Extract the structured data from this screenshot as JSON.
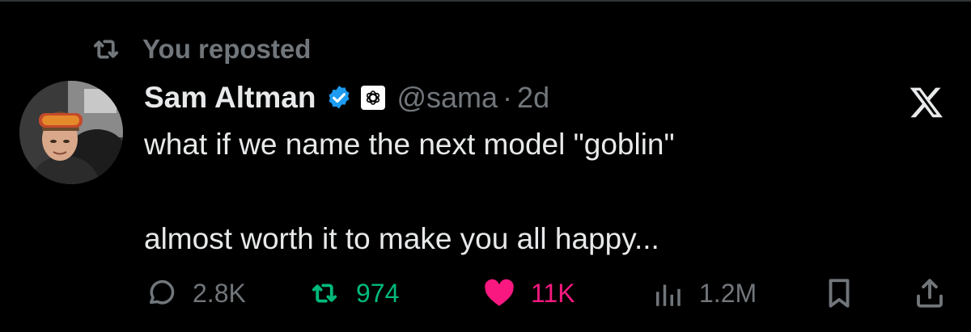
{
  "repost_banner": {
    "text": "You reposted",
    "icon": "repost-icon"
  },
  "author": {
    "name": "Sam Altman",
    "handle": "@sama",
    "separator": "·",
    "time": "2d",
    "verified_icon": "verified-badge-icon",
    "affiliation_icon": "openai-logo-icon"
  },
  "tweet": {
    "line1": "what if we name the next model \"goblin\"",
    "line2": "almost worth it to make you all happy..."
  },
  "actions": {
    "reply_count": "2.8K",
    "repost_count": "974",
    "like_count": "11K",
    "view_count": "1.2M"
  },
  "brand_icon": "x-logo-icon",
  "colors": {
    "background": "#000000",
    "text": "#e7e9ea",
    "muted": "#71767b",
    "repost_green": "#00ba7c",
    "like_pink": "#f91880",
    "verified_blue": "#1d9bf0"
  }
}
